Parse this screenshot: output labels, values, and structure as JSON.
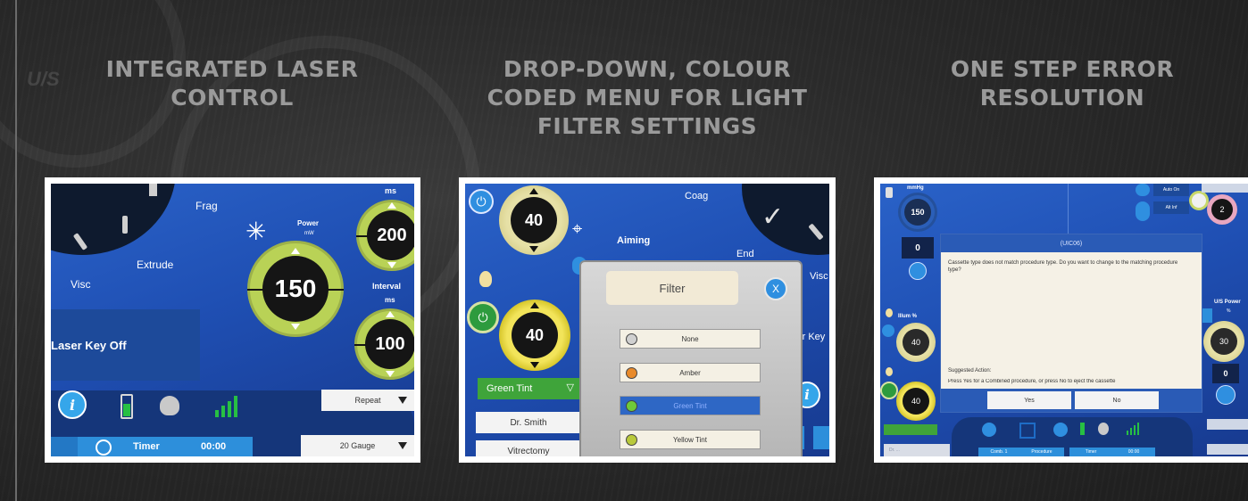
{
  "headings": {
    "left": [
      "INTEGRATED LASER",
      "CONTROL"
    ],
    "middle": [
      "DROP-DOWN, COLOUR",
      "CODED MENU FOR LIGHT",
      "FILTER SETTINGS"
    ],
    "right": [
      "ONE STEP ERROR",
      "RESOLUTION"
    ]
  },
  "background_mark": "U/S",
  "colors": {
    "panel_blue": "#1f4fb3",
    "dial_green": "#b9d256",
    "dial_yellow": "#f2e45a",
    "selected_blue": "#2e67c5"
  },
  "laser_screen": {
    "frag_label": "Frag",
    "extrude_label": "Extrude",
    "visc_label": "Visc",
    "power_label": "Power",
    "power_unit": "mW",
    "power_value": "150",
    "ms_label": "ms",
    "top_value": "200",
    "interval_label": "Interval",
    "interval_unit": "ms",
    "interval_value": "100",
    "laser_key": "Laser Key Off",
    "repeat_label": "Repeat",
    "gauge_label": "20 Gauge",
    "timer_label": "Timer",
    "timer_value": "00:00",
    "info_glyph": "i",
    "icons": [
      "laser-burst-icon",
      "battery-icon",
      "footswitch-icon",
      "signal-bars-icon",
      "clock-icon",
      "info-icon"
    ]
  },
  "filter_screen": {
    "coag_label": "Coag",
    "aiming_label": "Aiming",
    "end_label": "End",
    "visc_label": "Visc",
    "laser_key_fragment": "ser Key",
    "top_dial_value": "40",
    "lower_dial_value": "40",
    "green_tint_button": "Green Tint",
    "surgeon_label": "Dr. Smith",
    "procedure_label": "Vitrectomy",
    "dialog_title": "Filter",
    "close_glyph": "X",
    "options": [
      {
        "label": "None",
        "led": "#d0d0d0",
        "selected": false
      },
      {
        "label": "Amber",
        "led": "#e88a2a",
        "selected": false
      },
      {
        "label": "Green Tint",
        "led": "#6fc93a",
        "selected": true
      },
      {
        "label": "Yellow Tint",
        "led": "#b9c93a",
        "selected": false
      }
    ],
    "info_glyph": "i"
  },
  "error_screen": {
    "vac_label": "mmHg",
    "vac_value": "150",
    "vac_sub": "0",
    "illum_label": "Illum %",
    "illum_value": "40",
    "lower_value": "40",
    "auto_on": "Auto On",
    "alt_inf": "Alt Inf",
    "pill_value": "2",
    "us_power_label": "U/S Power",
    "us_unit": "%",
    "us_value": "30",
    "us_sub": "0",
    "dialog_title": "(UIC06)",
    "message": "Cassette type does not match procedure type.  Do you want to change to the matching procedure type?",
    "suggested_heading": "Suggested Action:",
    "suggested_text": "Press Yes for a  Combined procedure, or press No to eject the cassette",
    "yes_label": "Yes",
    "no_label": "No",
    "timer_label": "Timer",
    "timer_value": "00:00",
    "bottom_left": "Dr. ...",
    "bottom_tab": "Comb. 1",
    "bottom_tab2": "Procedure"
  }
}
